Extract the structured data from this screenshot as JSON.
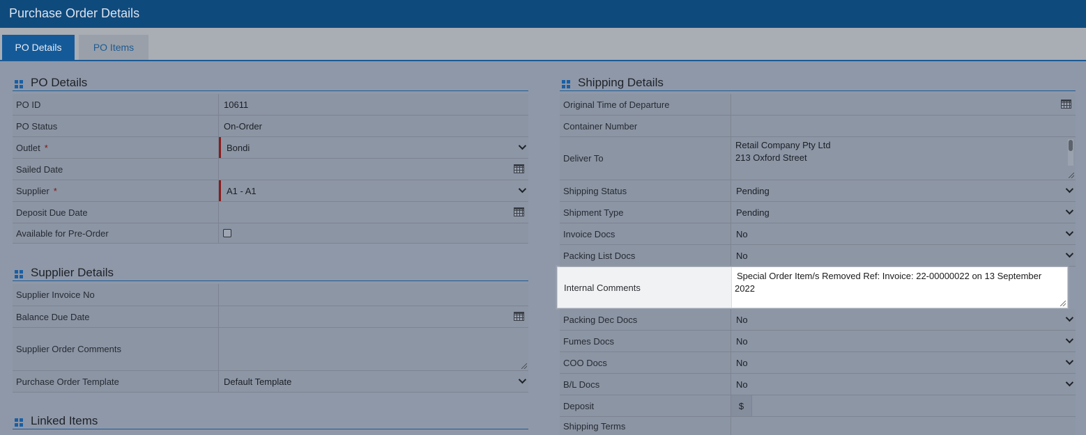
{
  "header": {
    "title": "Purchase Order Details"
  },
  "tabs": [
    {
      "label": "PO Details",
      "active": true
    },
    {
      "label": "PO Items",
      "active": false
    }
  ],
  "po_details": {
    "title": "PO Details",
    "po_id": {
      "label": "PO ID",
      "value": "10611"
    },
    "po_status": {
      "label": "PO Status",
      "value": "On-Order"
    },
    "outlet": {
      "label": "Outlet",
      "required_mark": "*",
      "value": "Bondi"
    },
    "sailed_date": {
      "label": "Sailed Date",
      "value": ""
    },
    "supplier": {
      "label": "Supplier",
      "required_mark": "*",
      "value": "A1 - A1"
    },
    "deposit_due_date": {
      "label": "Deposit Due Date",
      "value": ""
    },
    "available_preorder": {
      "label": "Available for Pre-Order",
      "checked": false
    }
  },
  "supplier_details": {
    "title": "Supplier Details",
    "invoice_no": {
      "label": "Supplier Invoice No",
      "value": ""
    },
    "balance_due_date": {
      "label": "Balance Due Date",
      "value": ""
    },
    "order_comments": {
      "label": "Supplier Order Comments",
      "value": ""
    },
    "template": {
      "label": "Purchase Order Template",
      "value": "Default Template"
    }
  },
  "linked_items": {
    "title": "Linked Items"
  },
  "shipping_details": {
    "title": "Shipping Details",
    "original_departure": {
      "label": "Original Time of Departure",
      "value": ""
    },
    "container_number": {
      "label": "Container Number",
      "value": ""
    },
    "deliver_to": {
      "label": "Deliver To",
      "line1": "Retail Company Pty Ltd",
      "line2": "213 Oxford Street"
    },
    "shipping_status": {
      "label": "Shipping Status",
      "value": "Pending"
    },
    "shipment_type": {
      "label": "Shipment Type",
      "value": "Pending"
    },
    "invoice_docs": {
      "label": "Invoice Docs",
      "value": "No"
    },
    "packing_list_docs": {
      "label": "Packing List Docs",
      "value": "No"
    },
    "internal_comments": {
      "label": "Internal Comments",
      "line1": "Special Order Item/s Removed Ref: Invoice: 22-00000022 on 13 September",
      "line2": "2022"
    },
    "packing_dec_docs": {
      "label": "Packing Dec Docs",
      "value": "No"
    },
    "fumes_docs": {
      "label": "Fumes Docs",
      "value": "No"
    },
    "coo_docs": {
      "label": "COO Docs",
      "value": "No"
    },
    "bl_docs": {
      "label": "B/L Docs",
      "value": "No"
    },
    "deposit": {
      "label": "Deposit",
      "currency": "$",
      "value": ""
    },
    "shipping_terms": {
      "label": "Shipping Terms",
      "value": ""
    }
  },
  "icons": {
    "section": "grid-icon",
    "dropdown": "chevron-down-icon",
    "date": "calendar-icon"
  },
  "colors": {
    "header_bg": "#0f4a7d",
    "tab_active": "#155a98",
    "required": "#8a1b1b"
  }
}
